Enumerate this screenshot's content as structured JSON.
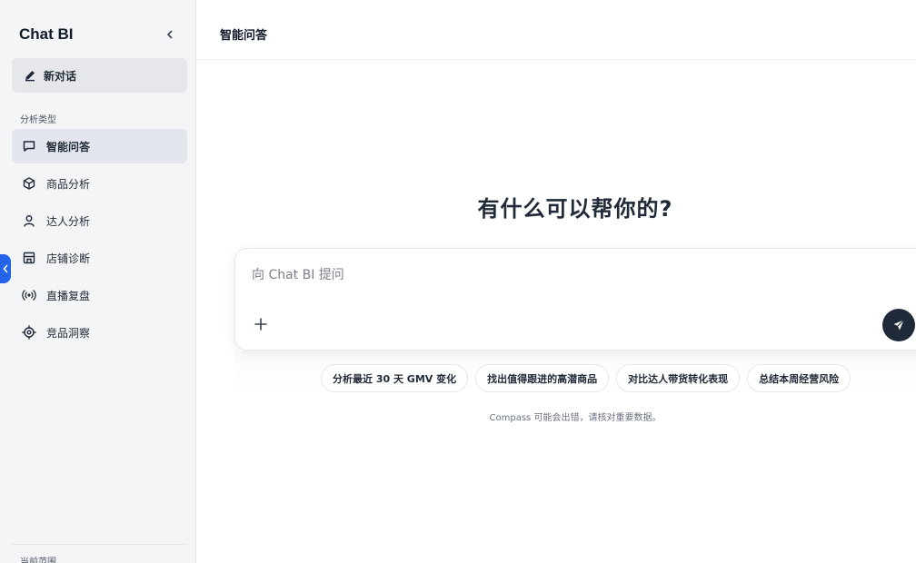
{
  "sidebar": {
    "title": "Chat BI",
    "new_chat_label": "新对话",
    "section_label": "分析类型",
    "items": [
      {
        "label": "智能问答",
        "icon": "chat-bubble-icon",
        "active": true
      },
      {
        "label": "商品分析",
        "icon": "cube-icon",
        "active": false
      },
      {
        "label": "达人分析",
        "icon": "user-icon",
        "active": false
      },
      {
        "label": "店铺诊断",
        "icon": "store-icon",
        "active": false
      },
      {
        "label": "直播复盘",
        "icon": "broadcast-icon",
        "active": false
      },
      {
        "label": "竞品洞察",
        "icon": "target-icon",
        "active": false
      }
    ],
    "footer_label": "当前范围"
  },
  "header": {
    "title": "智能问答"
  },
  "main": {
    "hero_title": "有什么可以帮你的?",
    "input_placeholder": "向 Chat BI 提问",
    "suggestions": [
      "分析最近 30 天 GMV 变化",
      "找出值得跟进的高潜商品",
      "对比达人带货转化表现",
      "总结本周经营风险"
    ],
    "disclaimer": "Compass 可能会出错，请核对重要数据。"
  },
  "colors": {
    "accent": "#2563eb",
    "send_button": "#1f2937",
    "sidebar_bg": "#f4f5f7"
  }
}
